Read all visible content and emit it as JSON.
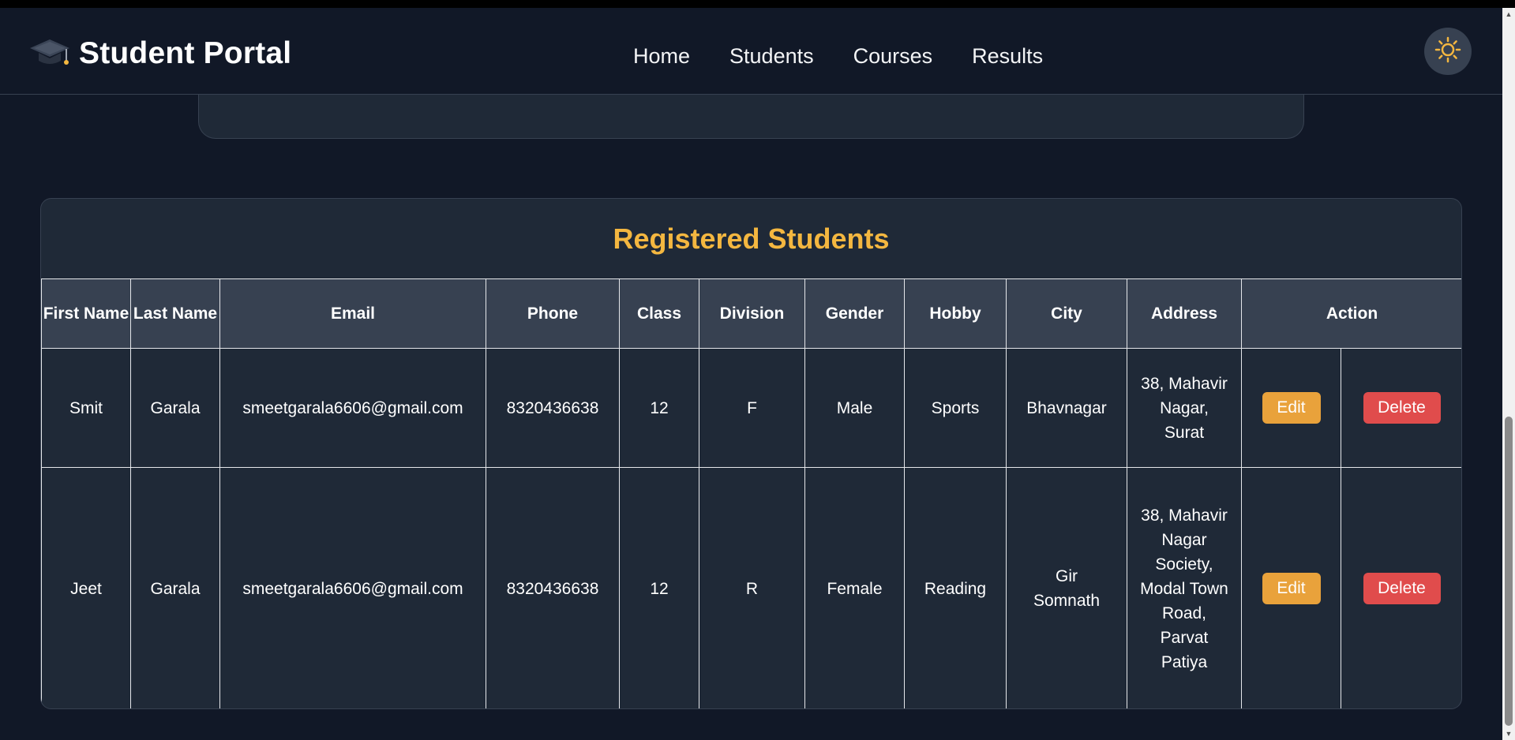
{
  "brand": {
    "title": "Student Portal",
    "icon": "graduation-cap-icon"
  },
  "nav": {
    "items": [
      "Home",
      "Students",
      "Courses",
      "Results"
    ]
  },
  "theme_toggle": {
    "icon": "sun-icon",
    "accent": "#f4b740"
  },
  "students_section": {
    "title": "Registered Students",
    "columns": [
      "First Name",
      "Last Name",
      "Email",
      "Phone",
      "Class",
      "Division",
      "Gender",
      "Hobby",
      "City",
      "Address",
      "Action"
    ],
    "rows": [
      {
        "first_name": "Smit",
        "last_name": "Garala",
        "email": "smeetgarala6606@gmail.com",
        "phone": "8320436638",
        "class": "12",
        "division": "F",
        "gender": "Male",
        "hobby": "Sports",
        "city": "Bhavnagar",
        "address": "38, Mahavir Nagar, Surat",
        "edit_label": "Edit",
        "delete_label": "Delete"
      },
      {
        "first_name": "Jeet",
        "last_name": "Garala",
        "email": "smeetgarala6606@gmail.com",
        "phone": "8320436638",
        "class": "12",
        "division": "R",
        "gender": "Female",
        "hobby": "Reading",
        "city": "Gir Somnath",
        "address": "38, Mahavir Nagar Society, Modal Town Road, Parvat Patiya",
        "edit_label": "Edit",
        "delete_label": "Delete"
      }
    ]
  },
  "colors": {
    "background": "#111827",
    "card": "#1f2937",
    "header": "#374151",
    "edit": "#e9a23b",
    "delete": "#e04c4c"
  }
}
